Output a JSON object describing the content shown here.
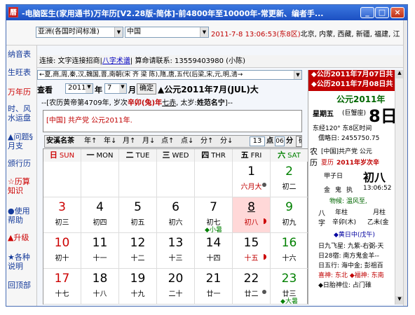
{
  "window": {
    "title": "-电脑医生(家用通书)万年历[V2.28版-简体]-前4800年至10000年-常更新、编者手...",
    "icon_char": "曆",
    "min_symbol": "_",
    "max_symbol": "□",
    "close_symbol": "×"
  },
  "toolbar": {
    "timezone": "亚洲(各国时间标准)",
    "country": "中国",
    "datetime": "2011-7-8  13:06:53(东8区)",
    "cities": "北京, 内蒙, 西藏, 新疆, 福建, 江"
  },
  "leftnav": [
    {
      "label": "纳音表",
      "color": "#143a9a"
    },
    {
      "label": "生旺表",
      "color": "#143a9a"
    },
    {
      "label": "万年历",
      "color": "#cc0000"
    },
    {
      "label": "时、风水运盘",
      "color": "#143a9a"
    },
    {
      "label": "▲问题§月支",
      "color": "#143a9a"
    },
    {
      "label": "颁行历",
      "color": "#143a9a"
    },
    {
      "label": "☆历算知识",
      "color": "#cc0000"
    },
    {
      "label": "●使用帮助",
      "color": "#143a9a"
    },
    {
      "label": "▲升级",
      "color": "#cc0000"
    },
    {
      "label": "★各种说明",
      "color": "#143a9a"
    },
    {
      "label": "回顶部",
      "color": "#143a9a"
    }
  ],
  "contact": {
    "prefix": "连接: 文字连接招商|",
    "link": "八字术谱",
    "suffix": "| 算命请联系: 13559403980 (小陈)"
  },
  "dynasty": "←夏,商,周,秦,汉,魏国,晋,南朝(宋 齐 梁 陈),隋,唐,五代(后梁,宋,元,明,清→",
  "lookup": {
    "label": "查看",
    "year": "2011",
    "year_unit": "年",
    "month": "7",
    "month_unit": "月",
    "confirm": "确定",
    "header": "▲公元2011年7月(JUL)大"
  },
  "lunarline": {
    "pre": "--[农历黄帝第4709年, 岁次",
    "ganzhi": "辛卯(兔)年",
    "star": "七赤",
    "taisui_pre": ", 太岁:",
    "taisui": "姓范名宁",
    "post": "]--"
  },
  "note": "[中国] 共产党 公元2011年.",
  "navrow": {
    "anming": "安溪名茶",
    "buttons": [
      "年↑",
      "年↓",
      "月↑",
      "月↓",
      "点↑",
      "点↓",
      "分↑",
      "分↓"
    ],
    "hour": "13",
    "hour_unit": "点",
    "minute": "06",
    "minute_unit": "分",
    "confirm": "确定"
  },
  "weekdays": [
    {
      "cn": "日",
      "en": "SUN"
    },
    {
      "cn": "一",
      "en": "MON"
    },
    {
      "cn": "二",
      "en": "TUE"
    },
    {
      "cn": "三",
      "en": "WED"
    },
    {
      "cn": "四",
      "en": "THR"
    },
    {
      "cn": "五",
      "en": "FRI"
    },
    {
      "cn": "六",
      "en": "SAT"
    }
  ],
  "calendar": {
    "rows": [
      [
        null,
        null,
        null,
        null,
        null,
        {
          "d": "1",
          "l": "六月大",
          "x": "dot"
        },
        {
          "d": "2",
          "l": "初二"
        }
      ],
      [
        {
          "d": "3",
          "l": "初三"
        },
        {
          "d": "4",
          "l": "初四"
        },
        {
          "d": "5",
          "l": "初五"
        },
        {
          "d": "6",
          "l": "初六"
        },
        {
          "d": "7",
          "l": "初七",
          "t": "◆小暑"
        },
        {
          "d": "8",
          "l": "初八",
          "today": true,
          "x": "half"
        },
        {
          "d": "9",
          "l": "初九"
        }
      ],
      [
        {
          "d": "10",
          "l": "初十"
        },
        {
          "d": "11",
          "l": "十一"
        },
        {
          "d": "12",
          "l": "十二"
        },
        {
          "d": "13",
          "l": "十三"
        },
        {
          "d": "14",
          "l": "十四"
        },
        {
          "d": "15",
          "l": "十五",
          "x": "half"
        },
        {
          "d": "16",
          "l": "十六"
        }
      ],
      [
        {
          "d": "17",
          "l": "十七"
        },
        {
          "d": "18",
          "l": "十八"
        },
        {
          "d": "19",
          "l": "十九"
        },
        {
          "d": "20",
          "l": "二十"
        },
        {
          "d": "21",
          "l": "廿一"
        },
        {
          "d": "22",
          "l": "廿二",
          "x": "dot"
        },
        {
          "d": "23",
          "l": "廿三",
          "t": "◆大暑"
        }
      ]
    ]
  },
  "rightpanel": {
    "red_line1": "◆公历2011年7月07日共",
    "red_line2": "◆公历2011年7月08日共",
    "gongyuan": "公元2011年",
    "weekday": "星期五",
    "sign": "(巨蟹座)",
    "bigday": "8日",
    "east": "东经120° 东8区时间",
    "julian": "儒略日: 2455750.75",
    "nong_prefix": "农",
    "nong_text": "[中国]共产党 公元",
    "li_prefix": "历",
    "xiali": "夏历",
    "xiali_text": "2011年岁次辛",
    "jiazi": "甲子日",
    "chuba": "初八",
    "jin": "金",
    "gui": "鬼",
    "zhi": "执",
    "time": "13:06:52",
    "wuxing": "物候: 温风至,",
    "ba": "八",
    "zi": "字",
    "nianzhu": "年柱",
    "yuezhu": "月柱",
    "nz_val": "辛卯(木)",
    "yz_val": "乙未(金",
    "jiri": "◆黄日中(戊午)",
    "jiu": "日九飞星: 九紫-右弼-天",
    "xiu": "日28宿: 南方鬼金羊--",
    "wuxing2": "日五行: 海中金; 彭祖百",
    "xishen": "喜神: 东北 ◆福神: 东南",
    "taishen": "◆日胎神位: 占门碓"
  }
}
